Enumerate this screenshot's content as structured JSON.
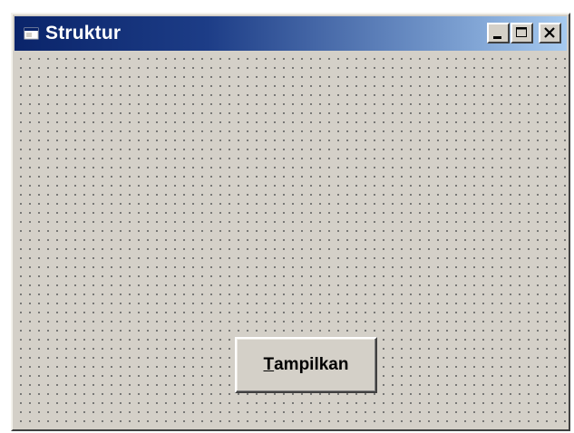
{
  "window": {
    "title": "Struktur",
    "app_icon": "form-window-icon",
    "controls": {
      "minimize_icon": "minimize-icon",
      "maximize_icon": "maximize-icon",
      "close_icon": "close-icon"
    }
  },
  "form": {
    "grid": "dotted design grid",
    "button": {
      "mnemonic": "T",
      "label_rest": "ampilkan"
    }
  },
  "colors": {
    "face": "#d4d0c8",
    "title_start": "#0a246a",
    "title_end": "#a6caf0",
    "title_text": "#ffffff"
  }
}
